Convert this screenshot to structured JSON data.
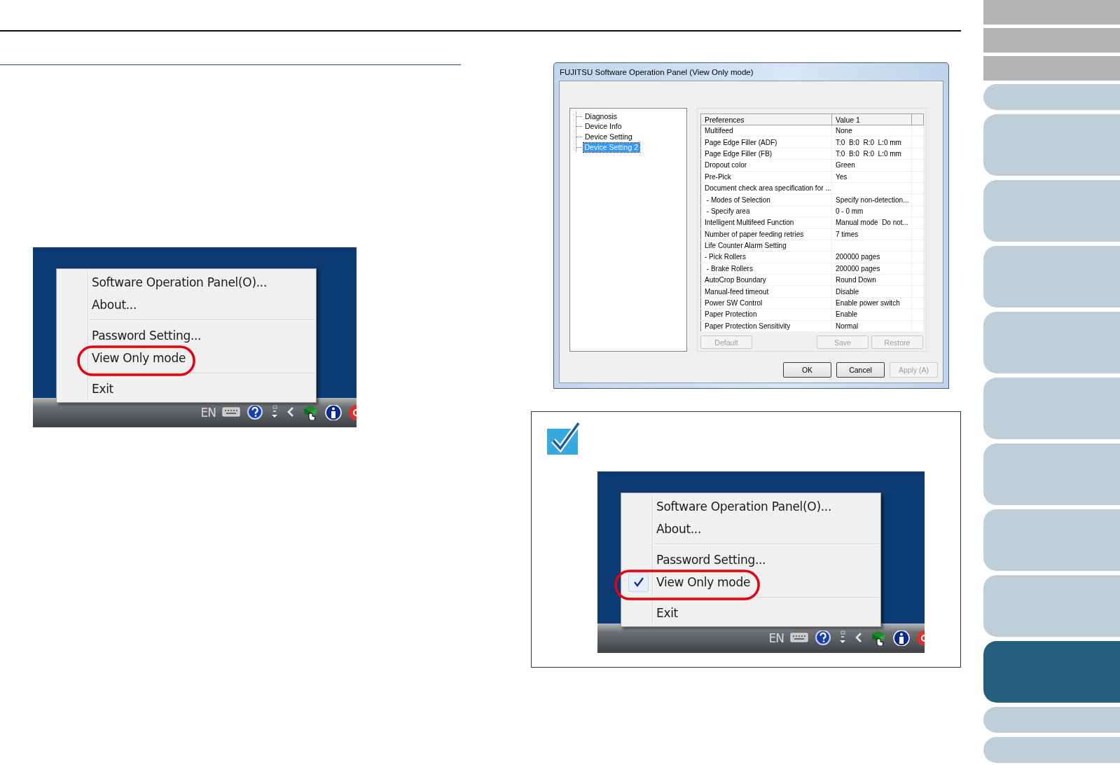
{
  "tray_menu_left": {
    "lang": "EN",
    "groups": [
      [
        {
          "label": "Software Operation Panel(O)...",
          "checked": false,
          "circled": false
        },
        {
          "label": "About...",
          "checked": false,
          "circled": false
        }
      ],
      [
        {
          "label": "Password Setting...",
          "checked": false,
          "circled": false
        },
        {
          "label": "View Only mode",
          "checked": false,
          "circled": true
        }
      ],
      [
        {
          "label": "Exit",
          "checked": false,
          "circled": false
        }
      ]
    ]
  },
  "dialog": {
    "title": "FUJITSU Software Operation Panel (View Only mode)",
    "tree": [
      {
        "label": "Diagnosis",
        "selected": false
      },
      {
        "label": "Device Info",
        "selected": false
      },
      {
        "label": "Device Setting",
        "selected": false
      },
      {
        "label": "Device Setting 2",
        "selected": true
      }
    ],
    "table": {
      "columns": [
        "Preferences",
        "Value 1"
      ],
      "rows": [
        [
          "Multifeed",
          "None"
        ],
        [
          "Page Edge Filler (ADF)",
          "T:0  B:0  R:0  L:0 mm"
        ],
        [
          "Page Edge Filler (FB)",
          "T:0  B:0  R:0  L:0 mm"
        ],
        [
          "Dropout color",
          "Green"
        ],
        [
          "Pre-Pick",
          "Yes"
        ],
        [
          "Document check area specification for ...",
          ""
        ],
        [
          " - Modes of Selection",
          "Specify non-detection..."
        ],
        [
          " - Specify area",
          "0 - 0 mm"
        ],
        [
          "Intelligent Multifeed Function",
          "Manual mode  Do not..."
        ],
        [
          "Number of paper feeding retries",
          "7 times"
        ],
        [
          "Life Counter Alarm Setting",
          ""
        ],
        [
          "- Pick Rollers",
          "200000 pages"
        ],
        [
          " - Brake Rollers",
          "200000 pages"
        ],
        [
          "AutoCrop Boundary",
          "Round Down"
        ],
        [
          "Manual-feed timeout",
          "Disable"
        ],
        [
          "Power SW Control",
          "Enable power switch"
        ],
        [
          "Paper Protection",
          "Enable"
        ],
        [
          "Paper Protection Sensitivity",
          "Normal"
        ]
      ]
    },
    "panel_buttons": [
      {
        "label": "Default",
        "disabled": true
      },
      {
        "label": "Save",
        "disabled": true
      },
      {
        "label": "Restore",
        "disabled": true
      }
    ],
    "buttons": [
      {
        "label": "OK",
        "disabled": false
      },
      {
        "label": "Cancel",
        "disabled": false
      },
      {
        "label": "Apply (A)",
        "disabled": true
      }
    ]
  },
  "tray_menu_note": {
    "lang": "EN",
    "groups": [
      [
        {
          "label": "Software Operation Panel(O)...",
          "checked": false,
          "circled": false
        },
        {
          "label": "About...",
          "checked": false,
          "circled": false
        }
      ],
      [
        {
          "label": "Password Setting...",
          "checked": false,
          "circled": false
        },
        {
          "label": "View Only mode",
          "checked": true,
          "circled": true
        }
      ],
      [
        {
          "label": "Exit",
          "checked": false,
          "circled": false
        }
      ]
    ]
  },
  "side_tabs": [
    {
      "kind": "square",
      "selected": false
    },
    {
      "kind": "square",
      "selected": false
    },
    {
      "kind": "square",
      "selected": false
    },
    {
      "kind": "rounded-short",
      "selected": false
    },
    {
      "kind": "rounded",
      "selected": false
    },
    {
      "kind": "rounded",
      "selected": false
    },
    {
      "kind": "rounded",
      "selected": false
    },
    {
      "kind": "rounded",
      "selected": false
    },
    {
      "kind": "rounded",
      "selected": false
    },
    {
      "kind": "rounded",
      "selected": false
    },
    {
      "kind": "rounded",
      "selected": false
    },
    {
      "kind": "rounded",
      "selected": false
    },
    {
      "kind": "rounded",
      "selected": true
    },
    {
      "kind": "rounded-short",
      "selected": false
    },
    {
      "kind": "rounded-short",
      "selected": false
    }
  ]
}
